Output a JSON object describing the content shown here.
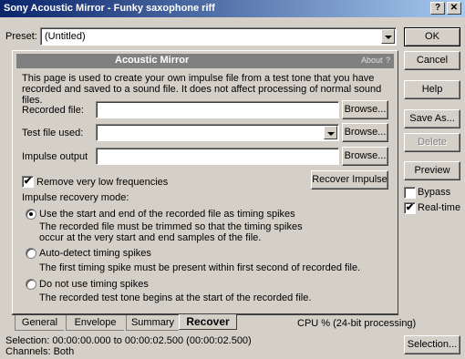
{
  "window": {
    "title": "Sony Acoustic Mirror - Funky saxophone riff",
    "help_btn": "?",
    "close_btn": "✕"
  },
  "preset": {
    "label": "Preset:",
    "value": "(Untitled)"
  },
  "header": {
    "title": "Acoustic Mirror",
    "about": "About",
    "about_q": "?"
  },
  "description": "This page is used to create your own impulse file from a test tone that you have recorded and saved to a sound file. It does not affect processing of normal sound files.",
  "fields": {
    "recorded_label": "Recorded file:",
    "recorded_value": "",
    "test_label": "Test file used:",
    "test_value": "",
    "impulse_label": "Impulse output",
    "impulse_value": "",
    "browse": "Browse..."
  },
  "remove_freq": {
    "label": "Remove very low frequencies",
    "checked": true
  },
  "recover_btn": "Recover Impulse",
  "mode": {
    "label": "Impulse recovery mode:",
    "options": [
      {
        "label": "Use the start and end of the recorded file as timing spikes",
        "desc": "The recorded file must be trimmed so that the timing spikes occur at the very start and end samples of the file.",
        "selected": true
      },
      {
        "label": "Auto-detect timing spikes",
        "desc": "The first timing spike must be present within first second of recorded file.",
        "selected": false
      },
      {
        "label": "Do not use timing spikes",
        "desc": "The recorded test tone begins at the start of the recorded file.",
        "selected": false
      }
    ]
  },
  "tabs": [
    "General",
    "Envelope",
    "Summary",
    "Recover"
  ],
  "active_tab": "Recover",
  "cpu": "CPU % (24-bit processing)",
  "status": {
    "selection": "Selection:  00:00:00.000 to 00:00:02.500 (00:00:02.500)",
    "channels": "Channels:  Both"
  },
  "side": {
    "ok": "OK",
    "cancel": "Cancel",
    "help": "Help",
    "save_as": "Save As...",
    "delete": "Delete",
    "preview": "Preview",
    "bypass": "Bypass",
    "bypass_checked": false,
    "realtime": "Real-time",
    "realtime_checked": true,
    "selection": "Selection..."
  },
  "colors": {
    "title_start": "#0a246a",
    "title_end": "#a6caf0",
    "face": "#d4d0c8",
    "header_bg": "#808080"
  }
}
